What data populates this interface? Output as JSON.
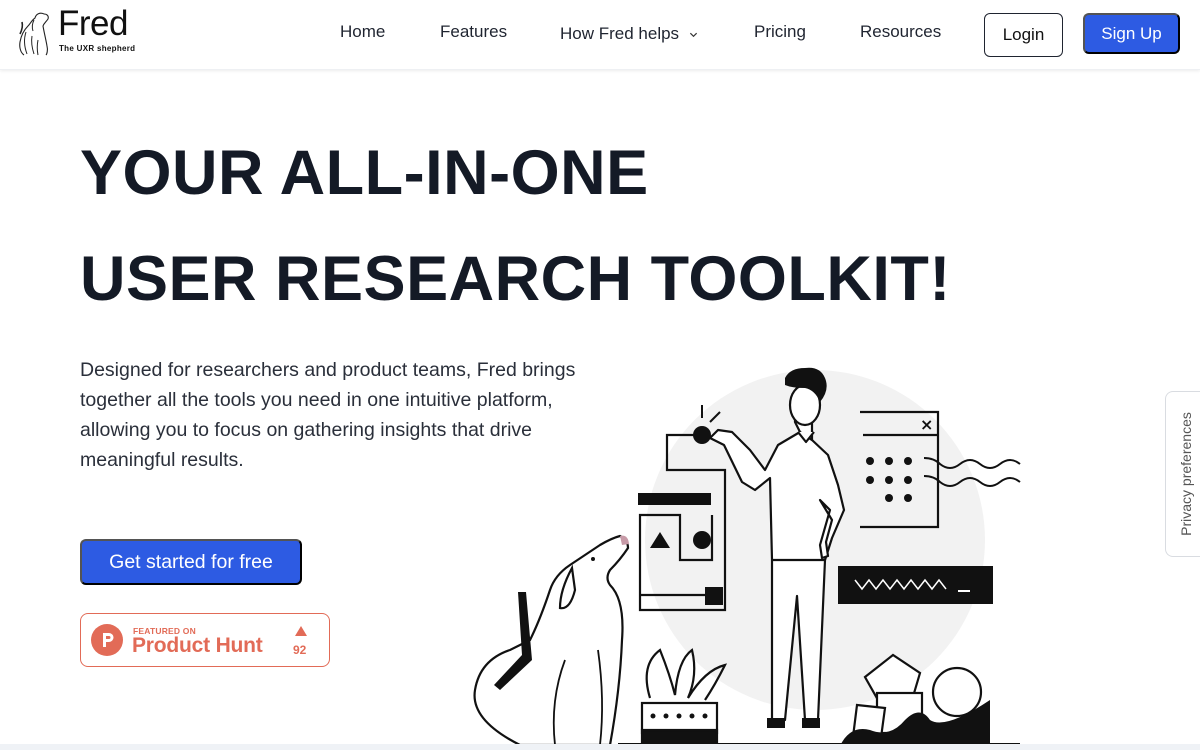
{
  "brand": {
    "name": "Fred",
    "tagline": "The UXR shepherd"
  },
  "nav": {
    "items": [
      {
        "label": "Home"
      },
      {
        "label": "Features"
      },
      {
        "label": "How Fred helps",
        "has_dropdown": true
      },
      {
        "label": "Pricing"
      },
      {
        "label": "Resources"
      }
    ],
    "login_label": "Login",
    "signup_label": "Sign Up"
  },
  "hero": {
    "title_line1": "YOUR ALL-IN-ONE",
    "title_line2": "USER RESEARCH TOOLKIT!",
    "description": "Designed for researchers and product teams, Fred brings together all the tools you need in one intuitive platform, allowing you to focus on gathering insights that drive meaningful results.",
    "cta_label": "Get started for free"
  },
  "product_hunt": {
    "featured_label": "FEATURED ON",
    "name": "Product Hunt",
    "votes": "92",
    "color": "#e26b57"
  },
  "privacy_tab": {
    "label": "Privacy preferences"
  },
  "colors": {
    "primary": "#2d5be3",
    "heading": "#141a26",
    "text": "#2a2f3a",
    "illustration_bg": "#f2f2f2",
    "dog_nose": "#c79aa7"
  }
}
